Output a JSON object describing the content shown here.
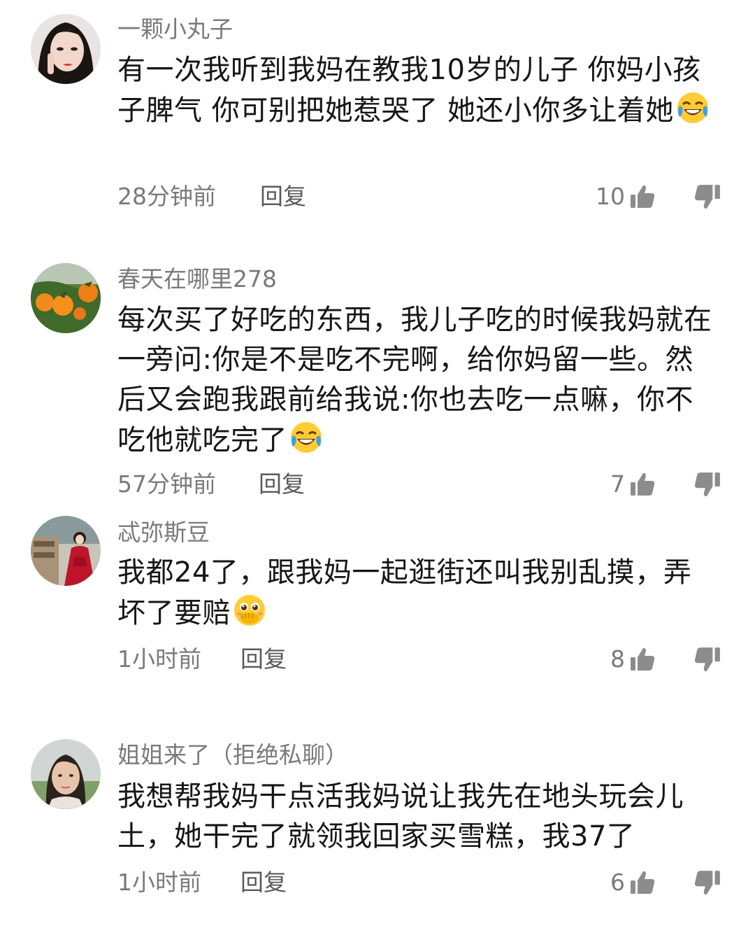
{
  "comments": [
    {
      "username": "一颗小丸子",
      "text": "有一次我听到我妈在教我10岁的儿子  你妈小孩子脾气  你可别把她惹哭了  她还小你多让着她",
      "emoji": "laughing-crying-emoji",
      "time": "28分钟前",
      "reply_label": "回复",
      "likes": "10"
    },
    {
      "username": "春天在哪里278",
      "text": "每次买了好吃的东西，我儿子吃的时候我妈就在一旁问:你是不是吃不完啊，给你妈留一些。然后又会跑我跟前给我说:你也去吃一点嘛，你不吃他就吃完了",
      "emoji": "laughing-crying-emoji",
      "time": "57分钟前",
      "reply_label": "回复",
      "likes": "7"
    },
    {
      "username": "忒弥斯豆",
      "text": "我都24了，跟我妈一起逛街还叫我别乱摸，弄坏了要赔",
      "emoji": "pleading-hand-over-mouth-emoji",
      "time": "1小时前",
      "reply_label": "回复",
      "likes": "8"
    },
    {
      "username": "姐姐来了（拒绝私聊）",
      "text": "我想帮我妈干点活我妈说让我先在地头玩会儿土，她干完了就领我回家买雪糕，我37了",
      "emoji": "",
      "time": "1小时前",
      "reply_label": "回复",
      "likes": "6"
    }
  ],
  "icons": {
    "like": "thumbs-up-icon",
    "dislike": "thumbs-down-icon"
  },
  "colors": {
    "meta_gray": "#7a7a7a",
    "text": "#161616",
    "icon_gray": "#8c8c8c"
  }
}
